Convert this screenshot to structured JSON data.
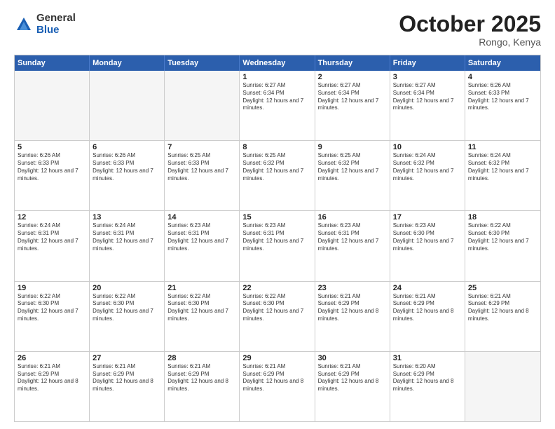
{
  "header": {
    "logo_general": "General",
    "logo_blue": "Blue",
    "month_title": "October 2025",
    "subtitle": "Rongo, Kenya"
  },
  "days_of_week": [
    "Sunday",
    "Monday",
    "Tuesday",
    "Wednesday",
    "Thursday",
    "Friday",
    "Saturday"
  ],
  "weeks": [
    [
      {
        "day": "",
        "empty": true
      },
      {
        "day": "",
        "empty": true
      },
      {
        "day": "",
        "empty": true
      },
      {
        "day": "1",
        "sunrise": "6:27 AM",
        "sunset": "6:34 PM",
        "daylight": "12 hours and 7 minutes."
      },
      {
        "day": "2",
        "sunrise": "6:27 AM",
        "sunset": "6:34 PM",
        "daylight": "12 hours and 7 minutes."
      },
      {
        "day": "3",
        "sunrise": "6:27 AM",
        "sunset": "6:34 PM",
        "daylight": "12 hours and 7 minutes."
      },
      {
        "day": "4",
        "sunrise": "6:26 AM",
        "sunset": "6:33 PM",
        "daylight": "12 hours and 7 minutes."
      }
    ],
    [
      {
        "day": "5",
        "sunrise": "6:26 AM",
        "sunset": "6:33 PM",
        "daylight": "12 hours and 7 minutes."
      },
      {
        "day": "6",
        "sunrise": "6:26 AM",
        "sunset": "6:33 PM",
        "daylight": "12 hours and 7 minutes."
      },
      {
        "day": "7",
        "sunrise": "6:25 AM",
        "sunset": "6:33 PM",
        "daylight": "12 hours and 7 minutes."
      },
      {
        "day": "8",
        "sunrise": "6:25 AM",
        "sunset": "6:32 PM",
        "daylight": "12 hours and 7 minutes."
      },
      {
        "day": "9",
        "sunrise": "6:25 AM",
        "sunset": "6:32 PM",
        "daylight": "12 hours and 7 minutes."
      },
      {
        "day": "10",
        "sunrise": "6:24 AM",
        "sunset": "6:32 PM",
        "daylight": "12 hours and 7 minutes."
      },
      {
        "day": "11",
        "sunrise": "6:24 AM",
        "sunset": "6:32 PM",
        "daylight": "12 hours and 7 minutes."
      }
    ],
    [
      {
        "day": "12",
        "sunrise": "6:24 AM",
        "sunset": "6:31 PM",
        "daylight": "12 hours and 7 minutes."
      },
      {
        "day": "13",
        "sunrise": "6:24 AM",
        "sunset": "6:31 PM",
        "daylight": "12 hours and 7 minutes."
      },
      {
        "day": "14",
        "sunrise": "6:23 AM",
        "sunset": "6:31 PM",
        "daylight": "12 hours and 7 minutes."
      },
      {
        "day": "15",
        "sunrise": "6:23 AM",
        "sunset": "6:31 PM",
        "daylight": "12 hours and 7 minutes."
      },
      {
        "day": "16",
        "sunrise": "6:23 AM",
        "sunset": "6:31 PM",
        "daylight": "12 hours and 7 minutes."
      },
      {
        "day": "17",
        "sunrise": "6:23 AM",
        "sunset": "6:30 PM",
        "daylight": "12 hours and 7 minutes."
      },
      {
        "day": "18",
        "sunrise": "6:22 AM",
        "sunset": "6:30 PM",
        "daylight": "12 hours and 7 minutes."
      }
    ],
    [
      {
        "day": "19",
        "sunrise": "6:22 AM",
        "sunset": "6:30 PM",
        "daylight": "12 hours and 7 minutes."
      },
      {
        "day": "20",
        "sunrise": "6:22 AM",
        "sunset": "6:30 PM",
        "daylight": "12 hours and 7 minutes."
      },
      {
        "day": "21",
        "sunrise": "6:22 AM",
        "sunset": "6:30 PM",
        "daylight": "12 hours and 7 minutes."
      },
      {
        "day": "22",
        "sunrise": "6:22 AM",
        "sunset": "6:30 PM",
        "daylight": "12 hours and 7 minutes."
      },
      {
        "day": "23",
        "sunrise": "6:21 AM",
        "sunset": "6:29 PM",
        "daylight": "12 hours and 8 minutes."
      },
      {
        "day": "24",
        "sunrise": "6:21 AM",
        "sunset": "6:29 PM",
        "daylight": "12 hours and 8 minutes."
      },
      {
        "day": "25",
        "sunrise": "6:21 AM",
        "sunset": "6:29 PM",
        "daylight": "12 hours and 8 minutes."
      }
    ],
    [
      {
        "day": "26",
        "sunrise": "6:21 AM",
        "sunset": "6:29 PM",
        "daylight": "12 hours and 8 minutes."
      },
      {
        "day": "27",
        "sunrise": "6:21 AM",
        "sunset": "6:29 PM",
        "daylight": "12 hours and 8 minutes."
      },
      {
        "day": "28",
        "sunrise": "6:21 AM",
        "sunset": "6:29 PM",
        "daylight": "12 hours and 8 minutes."
      },
      {
        "day": "29",
        "sunrise": "6:21 AM",
        "sunset": "6:29 PM",
        "daylight": "12 hours and 8 minutes."
      },
      {
        "day": "30",
        "sunrise": "6:21 AM",
        "sunset": "6:29 PM",
        "daylight": "12 hours and 8 minutes."
      },
      {
        "day": "31",
        "sunrise": "6:20 AM",
        "sunset": "6:29 PM",
        "daylight": "12 hours and 8 minutes."
      },
      {
        "day": "",
        "empty": true
      }
    ]
  ]
}
